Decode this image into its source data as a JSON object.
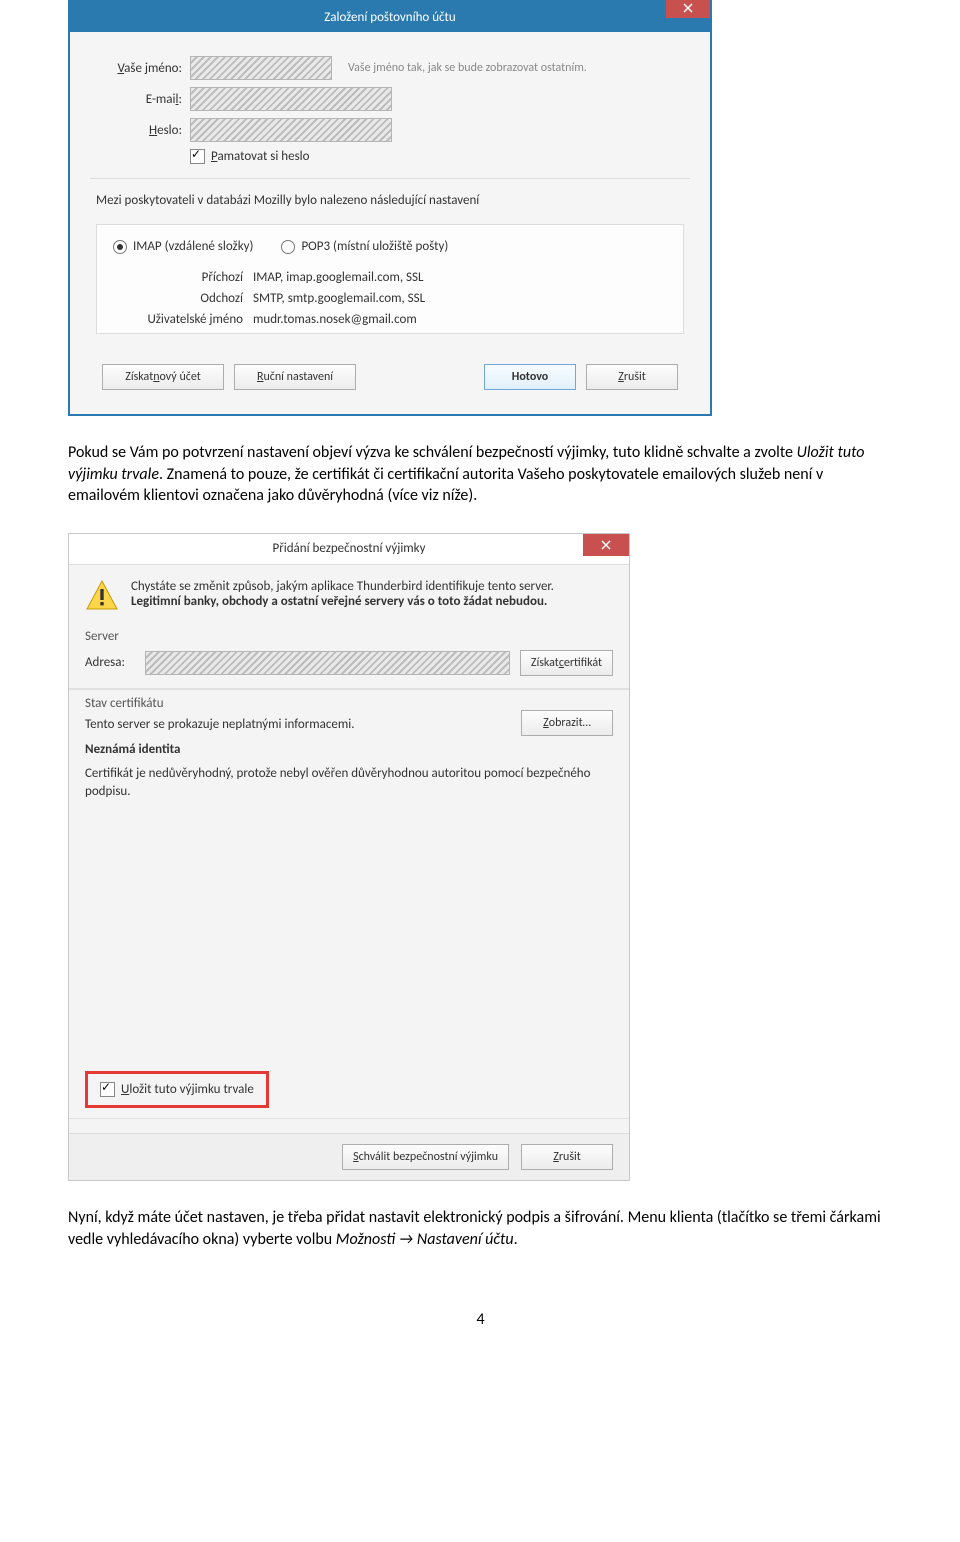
{
  "dlg1": {
    "title": "Založení poštovního účtu",
    "name_label": "Vaše jméno:",
    "name_hint": "Vaše jméno tak, jak se bude zobrazovat ostatním.",
    "email_label": "E-mail:",
    "pwd_label": "Heslo:",
    "remember_label": "Pamatovat si heslo",
    "found_msg": "Mezi poskytovateli v databázi Mozilly bylo nalezeno následující nastavení",
    "radio_imap": "IMAP (vzdálené složky)",
    "radio_pop3": "POP3 (místní uložiště pošty)",
    "row_in_k": "Příchozí",
    "row_in_v": "IMAP, imap.googlemail.com, SSL",
    "row_out_k": "Odchozí",
    "row_out_v": "SMTP, smtp.googlemail.com, SSL",
    "row_user_k": "Uživatelské jméno",
    "row_user_v": "mudr.tomas.nosek@gmail.com",
    "btn_new": "Získat nový účet",
    "btn_manual": "Ruční nastavení",
    "btn_done": "Hotovo",
    "btn_cancel": "Zrušit"
  },
  "para1": {
    "t1": "Pokud se Vám po potvrzení nastavení objeví výzva ke schválení bezpečností výjimky, tuto klidně schvalte a zvolte ",
    "t2": "Uložit tuto výjimku trvale",
    "t3": ". Znamená to pouze, že certifikát či certifikační autorita Vašeho poskytovatele emailových služeb není v emailovém  klientovi označena jako důvěryhodná (více viz níže)."
  },
  "dlg2": {
    "title": "Přidání bezpečnostní výjimky",
    "warn1": "Chystáte se změnit způsob, jakým aplikace Thunderbird identifikuje tento server.",
    "warn2": "Legitimní banky, obchody a ostatní veřejné servery vás o toto žádat nebudou.",
    "server": "Server",
    "adresa": "Adresa:",
    "btn_getcert": "Získat certifikát",
    "stav": "Stav certifikátu",
    "stav_msg": "Tento server se prokazuje neplatnými informacemi.",
    "btn_show": "Zobrazit…",
    "ident": "Neznámá identita",
    "certp": "Certifikát je nedůvěryhodný, protože nebyl ověřen důvěryhodnou autoritou pomocí bezpečného podpisu.",
    "store": "Uložit tuto výjimku trvale",
    "btn_confirm": "Schválit bezpečnostní výjimku",
    "btn_cancel": "Zrušit"
  },
  "para2": {
    "t1": "Nyní, když máte účet nastaven, je třeba přidat nastavit elektronický podpis a šifrování. Menu klienta (tlačítko se třemi čárkami vedle vyhledávacího okna) vyberte volbu ",
    "t2": "Možnosti ",
    "arrow": "→",
    "t3": " Nastavení účtu",
    "t4": "."
  },
  "page_no": "4"
}
